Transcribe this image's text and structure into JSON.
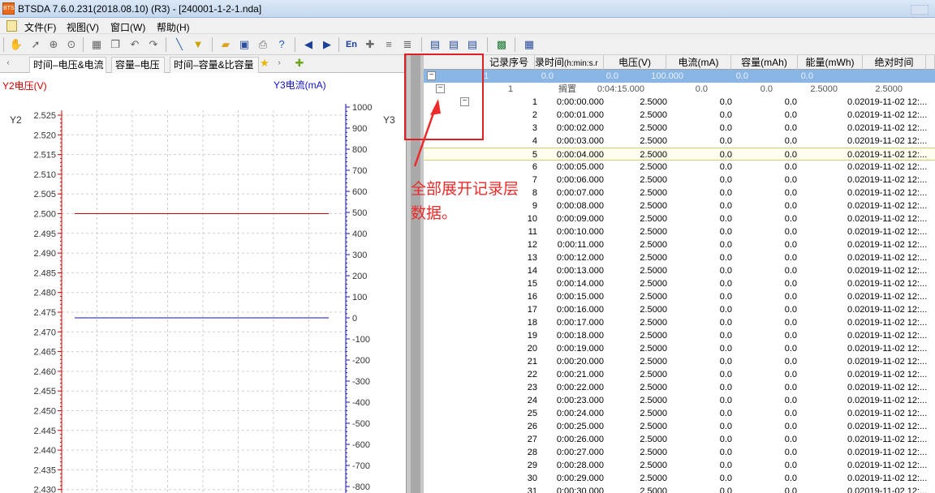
{
  "window": {
    "title": "BTSDA 7.6.0.231(2018.08.10) (R3) - [240001-1-2-1.nda]",
    "app_icon_text": "BTS"
  },
  "menu": [
    "文件(F)",
    "视图(V)",
    "窗口(W)",
    "帮助(H)"
  ],
  "toolbar_icons": [
    "hand-icon",
    "pointer-icon",
    "zoom-in-icon",
    "zoom-icon",
    "table-icon",
    "copy-icon",
    "undo-icon",
    "redo-icon",
    "pen-icon",
    "filter-icon",
    "open-folder-icon",
    "save-icon",
    "print-icon",
    "help-icon",
    "back-arrow-icon",
    "forward-arrow-icon",
    "en-icon",
    "pin-icon",
    "layers-icon",
    "layers-alt-icon",
    "grid-icon",
    "grid-alt-icon",
    "grid-alt2-icon",
    "excel-icon",
    "qr-icon"
  ],
  "toolbar": {
    "en_label": "En"
  },
  "tabs": [
    "时间–电压&电流",
    "容量–电压",
    "时间–容量&比容量"
  ],
  "chart_data": {
    "type": "line",
    "y2_label": "Y2电压(V)",
    "y3_label": "Y3电流(mA)",
    "y2_axis_name": "Y2",
    "y3_axis_name": "Y3",
    "y2_ticks": [
      "2.525",
      "2.520",
      "2.515",
      "2.510",
      "2.505",
      "2.500",
      "2.495",
      "2.490",
      "2.485",
      "2.480",
      "2.475",
      "2.470",
      "2.465",
      "2.460",
      "2.455",
      "2.450",
      "2.445",
      "2.440",
      "2.435",
      "2.430"
    ],
    "y3_ticks": [
      "1000",
      "900",
      "800",
      "700",
      "600",
      "500",
      "400",
      "300",
      "200",
      "100",
      "0",
      "-100",
      "-200",
      "-300",
      "-400",
      "-500",
      "-600",
      "-700",
      "-800"
    ],
    "y2_range": [
      2.43,
      2.525
    ],
    "y3_range": [
      -800,
      1000
    ],
    "grid": true,
    "series": [
      {
        "axis": "y2",
        "color": "#d00000",
        "value": 2.5
      },
      {
        "axis": "y3",
        "color": "#1010c0",
        "value": 0
      }
    ]
  },
  "table": {
    "headers": [
      "记录序号",
      "录时间",
      "(h:min:s.r",
      "电压(V)",
      "电流(mA)",
      "容量(mAh)",
      "能量(mWh)",
      "绝对时间"
    ],
    "row_cycle": [
      "1",
      "0.0",
      "0.0",
      "100.000",
      "0.0",
      "0.0"
    ],
    "row_step": [
      "1",
      "搁置",
      "0:04:15.000",
      "0.0",
      "0.0",
      "2.5000",
      "2.5000"
    ],
    "records": [
      [
        "1",
        "0:00:00.000",
        "2.5000",
        "0.0",
        "0.0",
        "0.02019-11-02 12:..."
      ],
      [
        "2",
        "0:00:01.000",
        "2.5000",
        "0.0",
        "0.0",
        "0.02019-11-02 12:..."
      ],
      [
        "3",
        "0:00:02.000",
        "2.5000",
        "0.0",
        "0.0",
        "0.02019-11-02 12:..."
      ],
      [
        "4",
        "0:00:03.000",
        "2.5000",
        "0.0",
        "0.0",
        "0.02019-11-02 12:..."
      ],
      [
        "5",
        "0:00:04.000",
        "2.5000",
        "0.0",
        "0.0",
        "0.02019-11-02 12:..."
      ],
      [
        "6",
        "0:00:05.000",
        "2.5000",
        "0.0",
        "0.0",
        "0.02019-11-02 12:..."
      ],
      [
        "7",
        "0:00:06.000",
        "2.5000",
        "0.0",
        "0.0",
        "0.02019-11-02 12:..."
      ],
      [
        "8",
        "0:00:07.000",
        "2.5000",
        "0.0",
        "0.0",
        "0.02019-11-02 12:..."
      ],
      [
        "9",
        "0:00:08.000",
        "2.5000",
        "0.0",
        "0.0",
        "0.02019-11-02 12:..."
      ],
      [
        "10",
        "0:00:09.000",
        "2.5000",
        "0.0",
        "0.0",
        "0.02019-11-02 12:..."
      ],
      [
        "11",
        "0:00:10.000",
        "2.5000",
        "0.0",
        "0.0",
        "0.02019-11-02 12:..."
      ],
      [
        "12",
        "0:00:11.000",
        "2.5000",
        "0.0",
        "0.0",
        "0.02019-11-02 12:..."
      ],
      [
        "13",
        "0:00:12.000",
        "2.5000",
        "0.0",
        "0.0",
        "0.02019-11-02 12:..."
      ],
      [
        "14",
        "0:00:13.000",
        "2.5000",
        "0.0",
        "0.0",
        "0.02019-11-02 12:..."
      ],
      [
        "15",
        "0:00:14.000",
        "2.5000",
        "0.0",
        "0.0",
        "0.02019-11-02 12:..."
      ],
      [
        "16",
        "0:00:15.000",
        "2.5000",
        "0.0",
        "0.0",
        "0.02019-11-02 12:..."
      ],
      [
        "17",
        "0:00:16.000",
        "2.5000",
        "0.0",
        "0.0",
        "0.02019-11-02 12:..."
      ],
      [
        "18",
        "0:00:17.000",
        "2.5000",
        "0.0",
        "0.0",
        "0.02019-11-02 12:..."
      ],
      [
        "19",
        "0:00:18.000",
        "2.5000",
        "0.0",
        "0.0",
        "0.02019-11-02 12:..."
      ],
      [
        "20",
        "0:00:19.000",
        "2.5000",
        "0.0",
        "0.0",
        "0.02019-11-02 12:..."
      ],
      [
        "21",
        "0:00:20.000",
        "2.5000",
        "0.0",
        "0.0",
        "0.02019-11-02 12:..."
      ],
      [
        "22",
        "0:00:21.000",
        "2.5000",
        "0.0",
        "0.0",
        "0.02019-11-02 12:..."
      ],
      [
        "23",
        "0:00:22.000",
        "2.5000",
        "0.0",
        "0.0",
        "0.02019-11-02 12:..."
      ],
      [
        "24",
        "0:00:23.000",
        "2.5000",
        "0.0",
        "0.0",
        "0.02019-11-02 12:..."
      ],
      [
        "25",
        "0:00:24.000",
        "2.5000",
        "0.0",
        "0.0",
        "0.02019-11-02 12:..."
      ],
      [
        "26",
        "0:00:25.000",
        "2.5000",
        "0.0",
        "0.0",
        "0.02019-11-02 12:..."
      ],
      [
        "27",
        "0:00:26.000",
        "2.5000",
        "0.0",
        "0.0",
        "0.02019-11-02 12:..."
      ],
      [
        "28",
        "0:00:27.000",
        "2.5000",
        "0.0",
        "0.0",
        "0.02019-11-02 12:..."
      ],
      [
        "29",
        "0:00:28.000",
        "2.5000",
        "0.0",
        "0.0",
        "0.02019-11-02 12:..."
      ],
      [
        "30",
        "0:00:29.000",
        "2.5000",
        "0.0",
        "0.0",
        "0.02019-11-02 12:..."
      ],
      [
        "31",
        "0:00:30.000",
        "2.5000",
        "0.0",
        "0.0",
        "0.02019-11-02 12:..."
      ]
    ],
    "selected_record": "5"
  },
  "annotation": {
    "line1": "全部展开记录层",
    "line2": "数据。",
    "color": "#ee2b2b"
  }
}
